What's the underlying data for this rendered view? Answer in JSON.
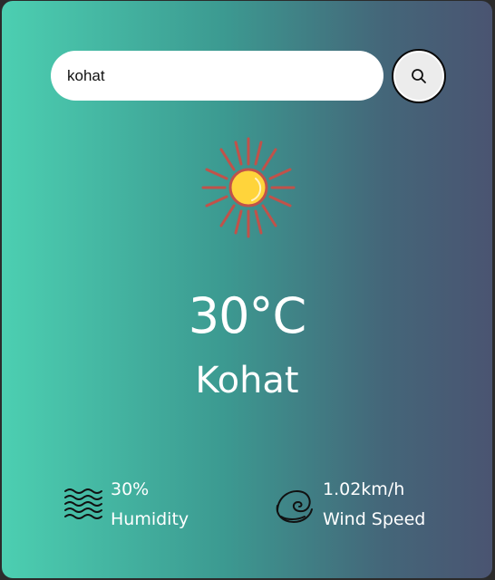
{
  "search": {
    "value": "kohat",
    "button_icon": "search-icon"
  },
  "weather": {
    "icon": "sun-icon",
    "temperature": "30°C",
    "city": "Kohat"
  },
  "details": {
    "humidity": {
      "icon": "humidity-waves-icon",
      "value": "30%",
      "label": "Humidity"
    },
    "wind": {
      "icon": "wind-swirl-icon",
      "value": "1.02km/h",
      "label": "Wind Speed"
    }
  },
  "colors": {
    "gradient_start": "#4ccfb1",
    "gradient_end": "#4a5471",
    "sun_fill": "#ffd43b",
    "sun_rays": "#c0524a"
  }
}
